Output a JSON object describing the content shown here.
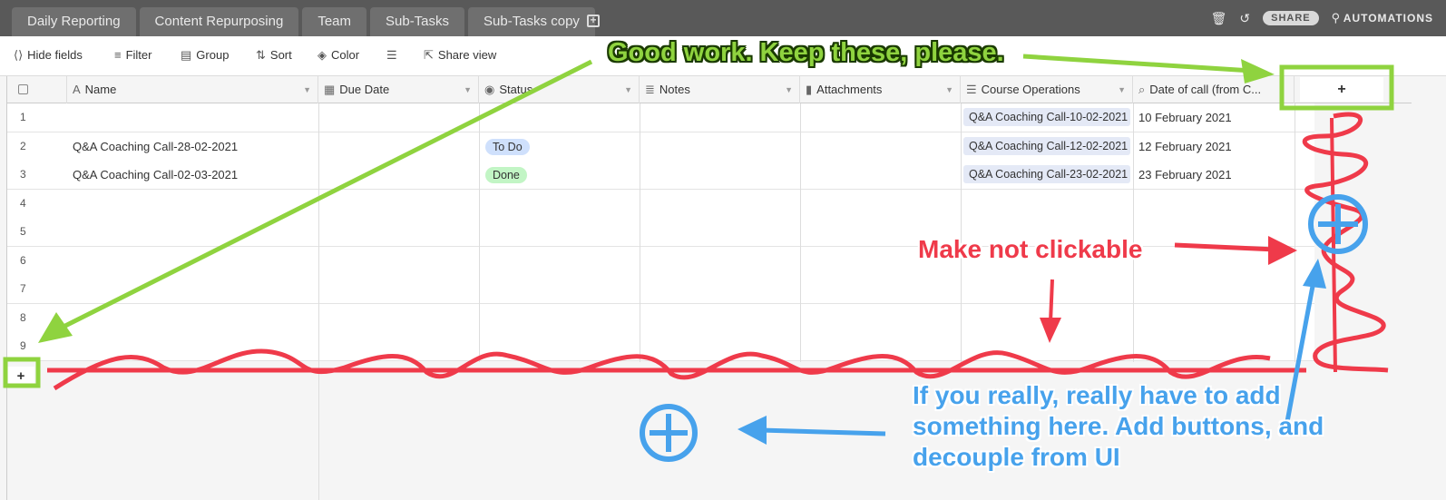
{
  "tabs": [
    "Daily Reporting",
    "Content Repurposing",
    "Team",
    "Sub-Tasks",
    "Sub-Tasks copy"
  ],
  "topbar": {
    "share": "SHARE",
    "automations": "AUTOMATIONS"
  },
  "toolbar": {
    "hide_fields": "Hide fields",
    "filter": "Filter",
    "group": "Group",
    "sort": "Sort",
    "color": "Color",
    "share_view": "Share view"
  },
  "columns": {
    "name": "Name",
    "due_date": "Due Date",
    "status": "Status",
    "notes": "Notes",
    "attachments": "Attachments",
    "course_operations": "Course Operations",
    "date_of_call": "Date of call (from C..."
  },
  "add_column": "+",
  "add_row": "+",
  "rows": [
    {
      "num": "1",
      "name": "",
      "status": "",
      "course_op": "Q&A Coaching Call-10-02-2021",
      "date": "10 February 2021"
    },
    {
      "num": "2",
      "name": "Q&A Coaching Call-28-02-2021",
      "status": "To Do",
      "course_op": "Q&A Coaching Call-12-02-2021",
      "date": "12 February 2021"
    },
    {
      "num": "3",
      "name": "Q&A Coaching Call-02-03-2021",
      "status": "Done",
      "course_op": "Q&A Coaching Call-23-02-2021",
      "date": "23 February 2021"
    },
    {
      "num": "4"
    },
    {
      "num": "5"
    },
    {
      "num": "6"
    },
    {
      "num": "7"
    },
    {
      "num": "8"
    },
    {
      "num": "9"
    }
  ],
  "annotations": {
    "green": "Good work. Keep these, please.",
    "red": "Make not clickable",
    "blue_line1": "If you really, really have to add",
    "blue_line2": "something here. Add buttons, and",
    "blue_line3": "decouple from UI"
  },
  "colors": {
    "annotation_green": "#8fd33f",
    "annotation_red": "#ef3a4a",
    "annotation_blue": "#47a2ec",
    "pill_todo": "#cfe0fc",
    "pill_done": "#c2f5c5"
  }
}
